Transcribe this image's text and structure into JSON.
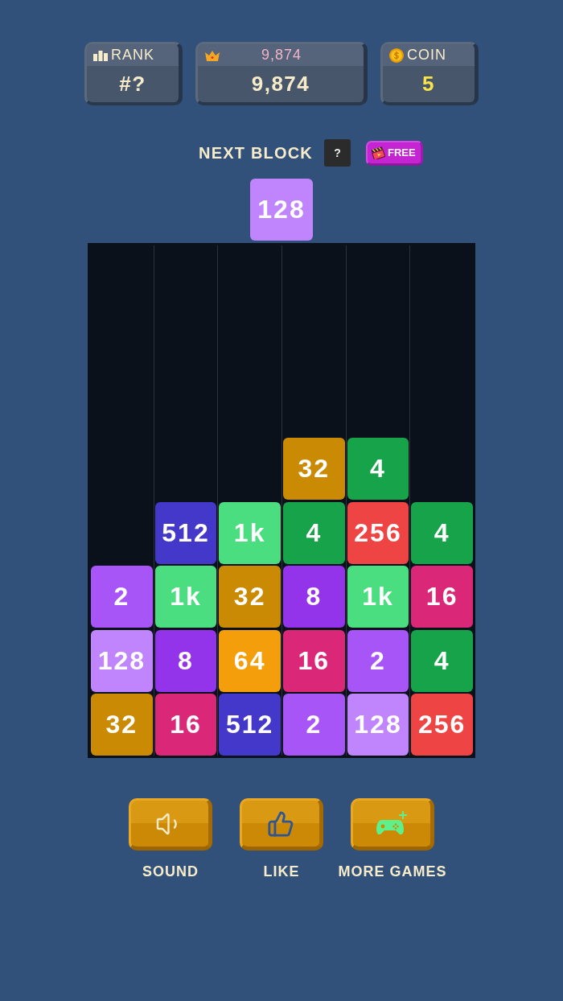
{
  "stats": [
    {
      "kind": "rank",
      "label": "RANK",
      "value": "#?"
    },
    {
      "kind": "score",
      "label": "9,874",
      "value": "9,874"
    },
    {
      "kind": "coin",
      "label": "COIN",
      "value": "5"
    }
  ],
  "next_block": {
    "label": "NEXT BLOCK",
    "preview": "?",
    "free_button": "FREE",
    "tile": {
      "label": "128",
      "color": "#c084fc"
    }
  },
  "board": {
    "columns": [
      {
        "tiles": [
          {
            "label": "2",
            "color": "#a855f7"
          },
          {
            "label": "128",
            "color": "#c084fc"
          },
          {
            "label": "32",
            "color": "#ca8a04"
          }
        ]
      },
      {
        "tiles": [
          {
            "label": "512",
            "color": "#4338ca"
          },
          {
            "label": "1k",
            "color": "#4ade80"
          },
          {
            "label": "8",
            "color": "#9333ea"
          },
          {
            "label": "16",
            "color": "#db2777"
          }
        ]
      },
      {
        "tiles": [
          {
            "label": "1k",
            "color": "#4ade80"
          },
          {
            "label": "32",
            "color": "#ca8a04"
          },
          {
            "label": "64",
            "color": "#f59e0b"
          },
          {
            "label": "512",
            "color": "#4338ca"
          }
        ]
      },
      {
        "tiles": [
          {
            "label": "32",
            "color": "#ca8a04"
          },
          {
            "label": "4",
            "color": "#16a34a"
          },
          {
            "label": "8",
            "color": "#9333ea"
          },
          {
            "label": "16",
            "color": "#db2777"
          },
          {
            "label": "2",
            "color": "#a855f7"
          }
        ]
      },
      {
        "tiles": [
          {
            "label": "4",
            "color": "#16a34a"
          },
          {
            "label": "256",
            "color": "#ef4444"
          },
          {
            "label": "1k",
            "color": "#4ade80"
          },
          {
            "label": "2",
            "color": "#a855f7"
          },
          {
            "label": "128",
            "color": "#c084fc"
          }
        ]
      },
      {
        "tiles": [
          {
            "label": "4",
            "color": "#16a34a"
          },
          {
            "label": "16",
            "color": "#db2777"
          },
          {
            "label": "4",
            "color": "#16a34a"
          },
          {
            "label": "256",
            "color": "#ef4444"
          }
        ]
      }
    ]
  },
  "buttons": [
    {
      "kind": "sound",
      "label": "SOUND"
    },
    {
      "kind": "like",
      "label": "LIKE"
    },
    {
      "kind": "more_games",
      "label": "MORE GAMES"
    }
  ]
}
